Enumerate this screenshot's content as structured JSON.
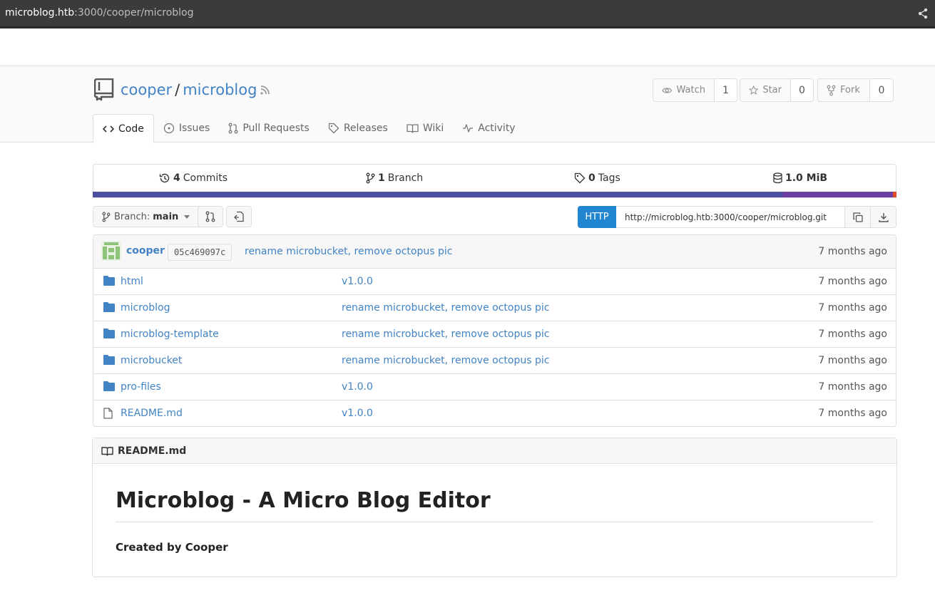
{
  "browser": {
    "url_host": "microblog.htb",
    "url_path": ":3000/cooper/microblog"
  },
  "repo": {
    "owner": "cooper",
    "separator": "/",
    "name": "microblog"
  },
  "actions": {
    "watch": {
      "label": "Watch",
      "count": "1"
    },
    "star": {
      "label": "Star",
      "count": "0"
    },
    "fork": {
      "label": "Fork",
      "count": "0"
    }
  },
  "tabs": [
    {
      "label": "Code",
      "icon": "code-icon",
      "active": true
    },
    {
      "label": "Issues",
      "icon": "issue-icon"
    },
    {
      "label": "Pull Requests",
      "icon": "pull-request-icon"
    },
    {
      "label": "Releases",
      "icon": "tag-icon"
    },
    {
      "label": "Wiki",
      "icon": "book-icon"
    },
    {
      "label": "Activity",
      "icon": "pulse-icon"
    }
  ],
  "stats": {
    "commits": {
      "count": "4",
      "label": "Commits"
    },
    "branches": {
      "count": "1",
      "label": "Branch"
    },
    "tags": {
      "count": "0",
      "label": "Tags"
    },
    "size": {
      "value": "1.0 MiB"
    }
  },
  "language_colors": [
    "#4a4fa0",
    "#6a3f9f",
    "#e34c26"
  ],
  "branch": {
    "label": "Branch:",
    "name": "main"
  },
  "clone": {
    "protocol": "HTTP",
    "url": "http://microblog.htb:3000/cooper/microblog.git"
  },
  "latest_commit": {
    "author": "cooper",
    "sha": "05c469097c",
    "message": "rename microbucket, remove octopus pic",
    "age": "7 months ago"
  },
  "files": [
    {
      "name": "html",
      "type": "folder",
      "message": "v1.0.0",
      "age": "7 months ago"
    },
    {
      "name": "microblog",
      "type": "folder",
      "message": "rename microbucket, remove octopus pic",
      "age": "7 months ago"
    },
    {
      "name": "microblog-template",
      "type": "folder",
      "message": "rename microbucket, remove octopus pic",
      "age": "7 months ago"
    },
    {
      "name": "microbucket",
      "type": "folder",
      "message": "rename microbucket, remove octopus pic",
      "age": "7 months ago"
    },
    {
      "name": "pro-files",
      "type": "folder",
      "message": "v1.0.0",
      "age": "7 months ago"
    },
    {
      "name": "README.md",
      "type": "file",
      "message": "v1.0.0",
      "age": "7 months ago"
    }
  ],
  "readme": {
    "filename": "README.md",
    "heading": "Microblog - A Micro Blog Editor",
    "body": "Created by Cooper"
  }
}
